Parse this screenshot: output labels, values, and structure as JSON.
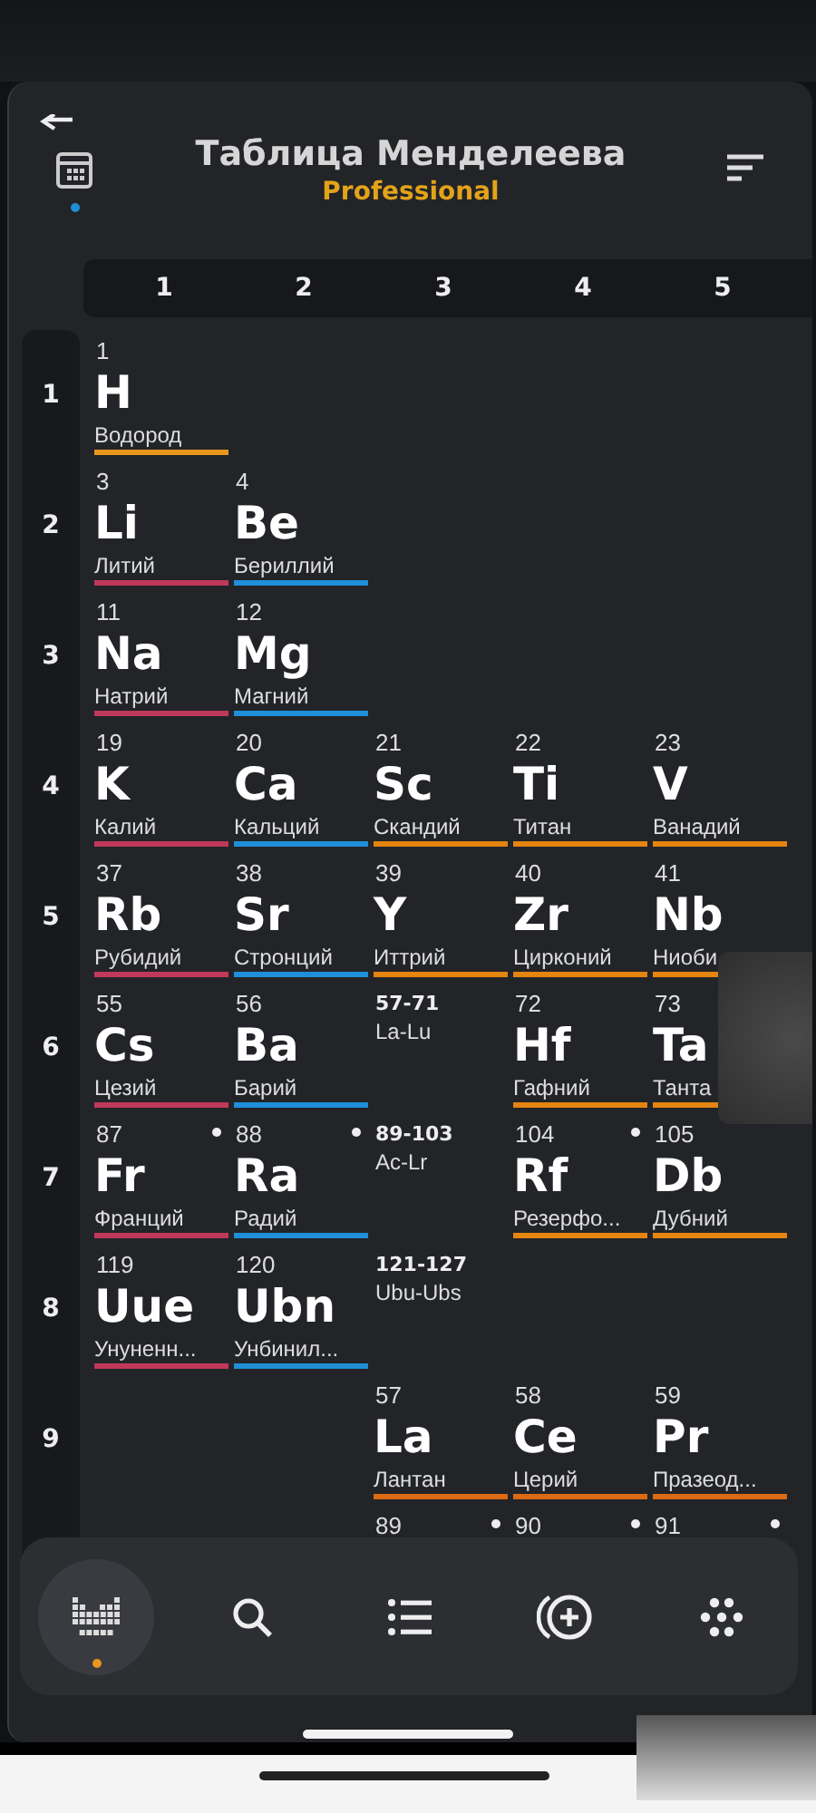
{
  "header": {
    "title": "Таблица Менделеева",
    "subtitle": "Professional"
  },
  "columns": [
    "1",
    "2",
    "3",
    "4",
    "5"
  ],
  "rows": [
    {
      "label": "1",
      "cells": [
        {
          "kind": "element",
          "number": "1",
          "symbol": "H",
          "name": "Водород",
          "color": "#e8961e",
          "radioactive": false
        }
      ]
    },
    {
      "label": "2",
      "cells": [
        {
          "kind": "element",
          "number": "3",
          "symbol": "Li",
          "name": "Литий",
          "color": "#c0385a",
          "radioactive": false
        },
        {
          "kind": "element",
          "number": "4",
          "symbol": "Be",
          "name": "Бериллий",
          "color": "#1f8fd8",
          "radioactive": false
        }
      ]
    },
    {
      "label": "3",
      "cells": [
        {
          "kind": "element",
          "number": "11",
          "symbol": "Na",
          "name": "Натрий",
          "color": "#c0385a",
          "radioactive": false
        },
        {
          "kind": "element",
          "number": "12",
          "symbol": "Mg",
          "name": "Магний",
          "color": "#1f8fd8",
          "radioactive": false
        }
      ]
    },
    {
      "label": "4",
      "cells": [
        {
          "kind": "element",
          "number": "19",
          "symbol": "K",
          "name": "Калий",
          "color": "#c0385a",
          "radioactive": false
        },
        {
          "kind": "element",
          "number": "20",
          "symbol": "Ca",
          "name": "Кальций",
          "color": "#1f8fd8",
          "radioactive": false
        },
        {
          "kind": "element",
          "number": "21",
          "symbol": "Sc",
          "name": "Скандий",
          "color": "#e5840f",
          "radioactive": false
        },
        {
          "kind": "element",
          "number": "22",
          "symbol": "Ti",
          "name": "Титан",
          "color": "#e5840f",
          "radioactive": false
        },
        {
          "kind": "element",
          "number": "23",
          "symbol": "V",
          "name": "Ванадий",
          "color": "#e5840f",
          "radioactive": false
        }
      ]
    },
    {
      "label": "5",
      "cells": [
        {
          "kind": "element",
          "number": "37",
          "symbol": "Rb",
          "name": "Рубидий",
          "color": "#c0385a",
          "radioactive": false
        },
        {
          "kind": "element",
          "number": "38",
          "symbol": "Sr",
          "name": "Стронций",
          "color": "#1f8fd8",
          "radioactive": false
        },
        {
          "kind": "element",
          "number": "39",
          "symbol": "Y",
          "name": "Иттрий",
          "color": "#e5840f",
          "radioactive": false
        },
        {
          "kind": "element",
          "number": "40",
          "symbol": "Zr",
          "name": "Цирконий",
          "color": "#e5840f",
          "radioactive": false
        },
        {
          "kind": "element",
          "number": "41",
          "symbol": "Nb",
          "name": "Ниоби",
          "color": "#e5840f",
          "radioactive": false
        }
      ]
    },
    {
      "label": "6",
      "cells": [
        {
          "kind": "element",
          "number": "55",
          "symbol": "Cs",
          "name": "Цезий",
          "color": "#c0385a",
          "radioactive": false
        },
        {
          "kind": "element",
          "number": "56",
          "symbol": "Ba",
          "name": "Барий",
          "color": "#1f8fd8",
          "radioactive": false
        },
        {
          "kind": "range",
          "range": "57-71",
          "symbols": "La-Lu"
        },
        {
          "kind": "element",
          "number": "72",
          "symbol": "Hf",
          "name": "Гафний",
          "color": "#e5840f",
          "radioactive": false
        },
        {
          "kind": "element",
          "number": "73",
          "symbol": "Ta",
          "name": "Танта",
          "color": "#e5840f",
          "radioactive": false
        }
      ]
    },
    {
      "label": "7",
      "cells": [
        {
          "kind": "element",
          "number": "87",
          "symbol": "Fr",
          "name": "Франций",
          "color": "#c0385a",
          "radioactive": true
        },
        {
          "kind": "element",
          "number": "88",
          "symbol": "Ra",
          "name": "Радий",
          "color": "#1f8fd8",
          "radioactive": true
        },
        {
          "kind": "range",
          "range": "89-103",
          "symbols": "Ac-Lr"
        },
        {
          "kind": "element",
          "number": "104",
          "symbol": "Rf",
          "name": "Резерфо...",
          "color": "#e5840f",
          "radioactive": true
        },
        {
          "kind": "element",
          "number": "105",
          "symbol": "Db",
          "name": "Дубний",
          "color": "#e5840f",
          "radioactive": false
        }
      ]
    },
    {
      "label": "8",
      "cells": [
        {
          "kind": "element",
          "number": "119",
          "symbol": "Uue",
          "name": "Унуненн...",
          "color": "#c0385a",
          "radioactive": false
        },
        {
          "kind": "element",
          "number": "120",
          "symbol": "Ubn",
          "name": "Унбинил...",
          "color": "#1f8fd8",
          "radioactive": false
        },
        {
          "kind": "range",
          "range": "121-127",
          "symbols": "Ubu-Ubs"
        }
      ]
    },
    {
      "label": "9",
      "cells": [
        {
          "kind": "empty"
        },
        {
          "kind": "empty"
        },
        {
          "kind": "element",
          "number": "57",
          "symbol": "La",
          "name": "Лантан",
          "color": "#dc6a12",
          "radioactive": false
        },
        {
          "kind": "element",
          "number": "58",
          "symbol": "Ce",
          "name": "Церий",
          "color": "#dc6a12",
          "radioactive": false
        },
        {
          "kind": "element",
          "number": "59",
          "symbol": "Pr",
          "name": "Празеод...",
          "color": "#dc6a12",
          "radioactive": false
        }
      ]
    },
    {
      "cells": [
        {
          "kind": "empty"
        },
        {
          "kind": "empty"
        },
        {
          "kind": "element",
          "number": "89",
          "radioactive": true
        },
        {
          "kind": "element",
          "number": "90",
          "radioactive": true
        },
        {
          "kind": "element",
          "number": "91",
          "radioactive": true
        }
      ]
    }
  ],
  "nav": [
    {
      "kind": "table",
      "selected": true
    },
    {
      "kind": "search",
      "selected": false
    },
    {
      "kind": "list",
      "selected": false
    },
    {
      "kind": "add",
      "selected": false
    },
    {
      "kind": "dots",
      "selected": false
    }
  ]
}
